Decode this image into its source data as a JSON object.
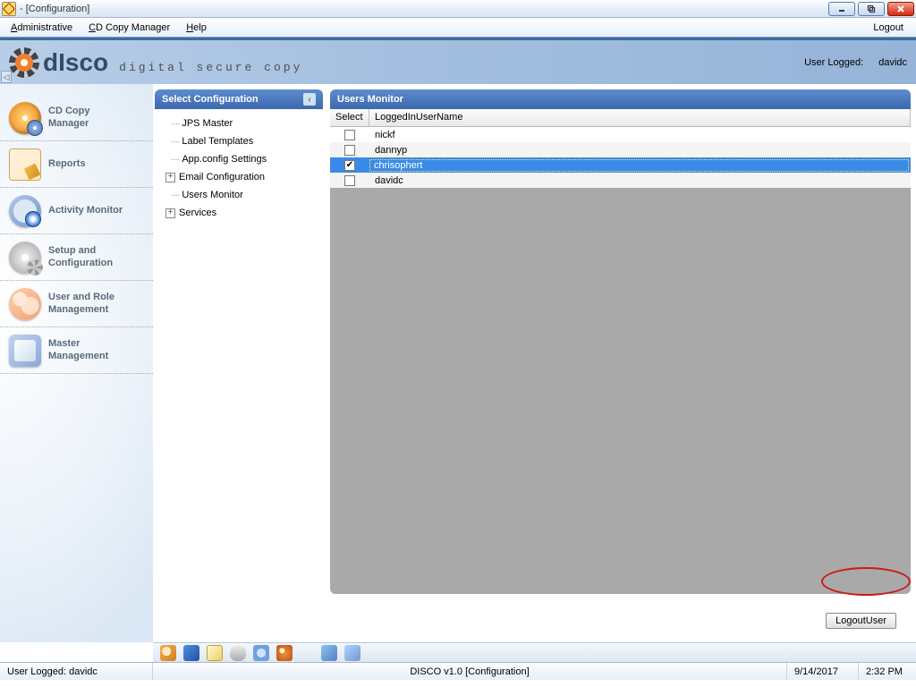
{
  "window": {
    "title": " - [Configuration]"
  },
  "menu": {
    "administrative": "Administrative",
    "cdcopy": "CD Copy Manager",
    "help": "Help",
    "logout": "Logout"
  },
  "brand": {
    "name": "dIsco",
    "tagline": "digital secure copy",
    "user_logged_label": "User Logged:",
    "user_logged_value": "davidc"
  },
  "nav": {
    "items": [
      {
        "label": "CD Copy\nManager"
      },
      {
        "label": "Reports"
      },
      {
        "label": "Activity Monitor"
      },
      {
        "label": "Setup and\nConfiguration"
      },
      {
        "label": "User and Role\nManagement"
      },
      {
        "label": "Master\nManagement"
      }
    ]
  },
  "config_panel": {
    "title": "Select Configuration",
    "items": [
      {
        "label": "JPS Master",
        "exp": ""
      },
      {
        "label": "Label Templates",
        "exp": ""
      },
      {
        "label": "App.config Settings",
        "exp": ""
      },
      {
        "label": "Email Configuration",
        "exp": "+"
      },
      {
        "label": "Users Monitor",
        "exp": ""
      },
      {
        "label": "Services",
        "exp": "+"
      }
    ]
  },
  "monitor_panel": {
    "title": "Users Monitor",
    "col_select": "Select",
    "col_user": "LoggedInUserName",
    "rows": [
      {
        "user": "nickf",
        "checked": false,
        "selected": false
      },
      {
        "user": "dannyp",
        "checked": false,
        "selected": false
      },
      {
        "user": "chrisophert",
        "checked": true,
        "selected": true
      },
      {
        "user": "davidc",
        "checked": false,
        "selected": false
      }
    ]
  },
  "actions": {
    "logout_user": "LogoutUser"
  },
  "status": {
    "left": "User Logged: davidc",
    "center": "DISCO v1.0 [Configuration]",
    "date": "9/14/2017",
    "time": "2:32 PM"
  }
}
